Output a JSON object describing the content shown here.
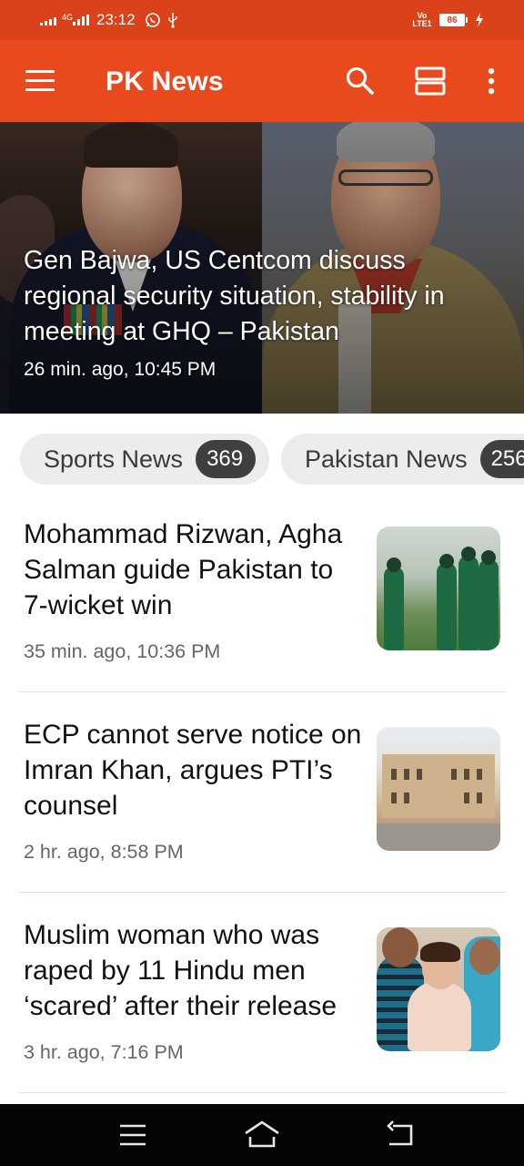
{
  "status_bar": {
    "network": "4G",
    "time": "23:12",
    "volte": "Vo LTE1",
    "battery": "86"
  },
  "app_bar": {
    "title": "PK News",
    "icons": [
      "menu-icon",
      "search-icon",
      "layout-toggle-icon",
      "more-vert-icon"
    ]
  },
  "featured": {
    "title": "Gen Bajwa, US Centcom discuss regional security situation, stability in meeting at GHQ – Pakistan",
    "time": "26 min. ago, 10:45 PM"
  },
  "categories": [
    {
      "label": "Sports News",
      "count": "369"
    },
    {
      "label": "Pakistan News",
      "count": "256"
    }
  ],
  "articles": [
    {
      "title": "Mohammad Rizwan, Agha Salman guide Pakistan to 7-wicket win",
      "time": "35 min. ago, 10:36 PM"
    },
    {
      "title": "ECP cannot serve notice on Imran Khan, argues PTI’s counsel",
      "time": "2 hr. ago, 8:58 PM"
    },
    {
      "title": "Muslim woman who was raped by 11 Hindu men ‘scared’ after their release",
      "time": "3 hr. ago, 7:16 PM"
    }
  ],
  "colors": {
    "status_bar": "#d9421a",
    "app_bar": "#e8491d",
    "chip_bg": "#ececec",
    "chip_count_bg": "#3f3f3f",
    "nav_bar": "#050505"
  },
  "nav_bar": {
    "icons": [
      "recent-apps-icon",
      "home-icon",
      "back-icon"
    ]
  }
}
